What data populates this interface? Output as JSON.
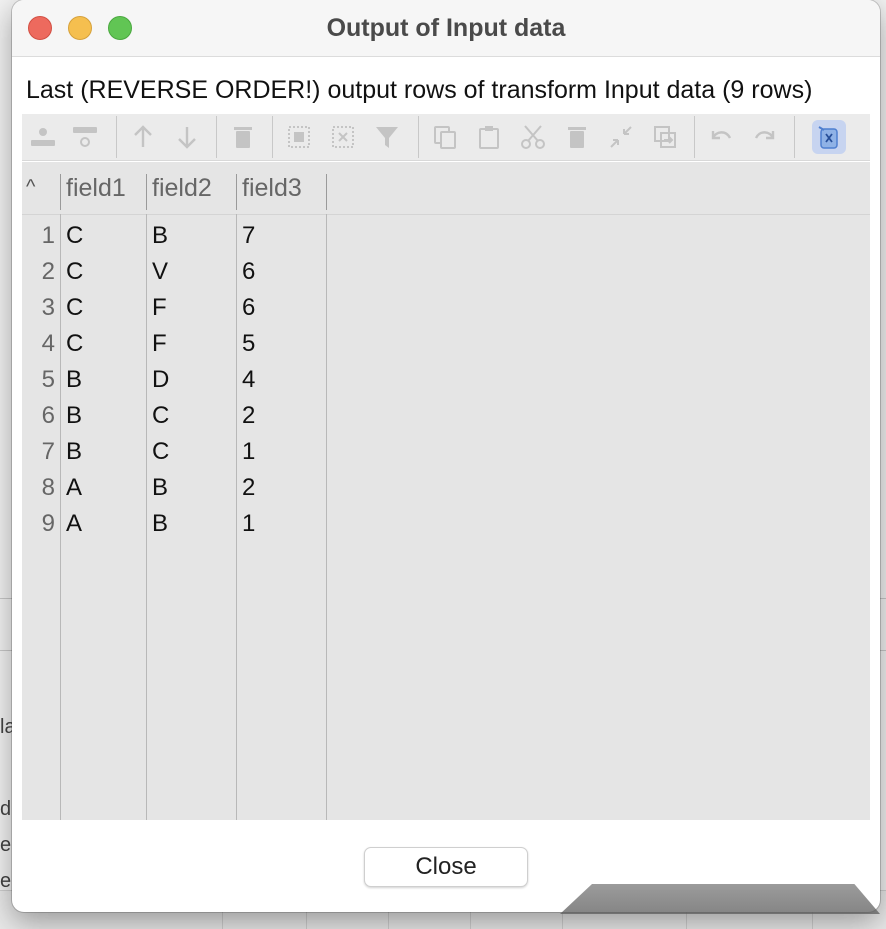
{
  "window": {
    "title": "Output of Input data",
    "description": "Last (REVERSE ORDER!) output rows of transform Input data (9 rows)"
  },
  "toolbar": {
    "icons": [
      "insert-row-icon",
      "delete-row-icon",
      "move-up-icon",
      "move-down-icon",
      "trash-icon",
      "select-all-icon",
      "clear-selection-icon",
      "filter-icon",
      "copy-icon",
      "paste-icon",
      "cut-icon",
      "delete-icon",
      "collapse-icon",
      "duplicate-icon",
      "undo-icon",
      "redo-icon",
      "export-excel-icon"
    ]
  },
  "table": {
    "sort_indicator": "^",
    "columns": [
      "field1",
      "field2",
      "field3"
    ],
    "rows": [
      [
        "1",
        "C",
        "B",
        "7"
      ],
      [
        "2",
        "C",
        "V",
        "6"
      ],
      [
        "3",
        "C",
        "F",
        "6"
      ],
      [
        "4",
        "C",
        "F",
        "5"
      ],
      [
        "5",
        "B",
        "D",
        "4"
      ],
      [
        "6",
        "B",
        "C",
        "2"
      ],
      [
        "7",
        "B",
        "C",
        "1"
      ],
      [
        "8",
        "A",
        "B",
        "2"
      ],
      [
        "9",
        "A",
        "B",
        "1"
      ]
    ]
  },
  "buttons": {
    "close_label": "Close"
  },
  "background_fragments": [
    "la",
    "d",
    "e",
    "e"
  ]
}
